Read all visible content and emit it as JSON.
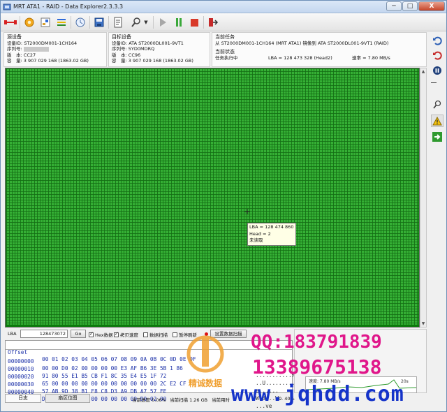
{
  "window": {
    "title": "MRT ATA1 - RAID - Data Explorer2.3.3.3",
    "controls": {
      "minimize": "─",
      "maximize": "□",
      "close": "X"
    }
  },
  "toolbar": {
    "icons": [
      "disk-link-icon",
      "gear-icon",
      "sector-icon",
      "chart-icon",
      "clock-icon",
      "save-icon",
      "document-icon",
      "tools-icon",
      "dropdown-icon",
      "play-icon",
      "pause-icon",
      "stop-icon",
      "exit-icon"
    ]
  },
  "source": {
    "header": "源设备",
    "device_id_label": "设备ID:",
    "device_id": "ST2000DM001-1CH164",
    "serial_label": "序列号:",
    "serial": "",
    "version_label": "版　本:",
    "version": "CC27",
    "capacity_label": "容　量:",
    "capacity": "3 907 029 168 (1863.02 GB)"
  },
  "target": {
    "header": "目标设备",
    "device_id_label": "设备ID:",
    "device_id": "ATA ST2000DL001-9VT1",
    "serial_label": "序列号:",
    "serial": "5YD0MDRQ",
    "version_label": "版　本:",
    "version": "CC96",
    "capacity_label": "容　量:",
    "capacity": "3 907 029 168 (1863.02 GB)"
  },
  "task": {
    "header": "当前任务",
    "description": "从 ST2000DM001-1CH164 (MRT ATA1) 镜像到 ATA ST2000DL001-9VT1 (RAID)",
    "status_header": "当前状态",
    "status": "任务执行中",
    "lba": "LBA = 128 473 328 (Head2)",
    "rate": "速率 = 7.80 MB/s"
  },
  "tooltip": {
    "lba": "LBA = 128 474 860",
    "head": "Head = 2",
    "state": "未读取"
  },
  "lba_bar": {
    "label": "LBA",
    "value": "128473072",
    "go": "Go",
    "hex_data": "Hex数据",
    "hex_checked": true,
    "copy_speed": "拷贝速度",
    "copy_checked": true,
    "data_scan": "数据扫描",
    "data_checked": false,
    "pause_refresh": "暂停刷新",
    "pause_checked": false,
    "scan_settings": "设置数据扫描"
  },
  "hex": {
    "header_offset": "Offset",
    "header_bytes": "00 01 02 03 04 05 06 07 08 09 0A 0B 0C 0D 0E 0F",
    "rows": [
      {
        "offset": "00000000",
        "bytes": "00 00 D0 02 00 00 00 00 E3 AF B6 3E 5B 1 86",
        "ascii": "...........>[."
      },
      {
        "offset": "00000010",
        "bytes": "91 80 55 E1 B5 CB F1 8C 35 E4 E5 1F 72 ",
        "ascii": "..U.........r"
      },
      {
        "offset": "00000020",
        "bytes": "65 00 00 00 00 00 00 00 00 00 00 00 2C E2 CF",
        "ascii": "e......"
      },
      {
        "offset": "00000030",
        "bytes": "57 AB 9D 38 B1 F8 C8 D3 A9 DB A7 57 FE ",
        "ascii": "W.8...W."
      },
      {
        "offset": "00000040",
        "bytes": "D4 00 C0 76 65 00 00 00 00 00 D0 02 00",
        "ascii": "...ve"
      }
    ]
  },
  "stats": {
    "chart_label": "速度: 7.80 MB/s",
    "chart_right": "20s"
  },
  "tabs": [
    "日志",
    "扇区位图"
  ],
  "statusbar": {
    "progress": "当前进度 0.06%",
    "scanned": "当前扫描 1.26 GB",
    "elapsed": "当前用时",
    "overall": "0. 40%"
  },
  "watermark": {
    "qq": "QQ:183791839",
    "phone": "13389675138",
    "url": "www.jqhdd.com",
    "logo_text": "精诚数据"
  },
  "colors": {
    "grid_green": "#35b035",
    "grid_line": "#146e14",
    "watermark_pink": "#e0168a",
    "watermark_blue": "#1533c9"
  }
}
